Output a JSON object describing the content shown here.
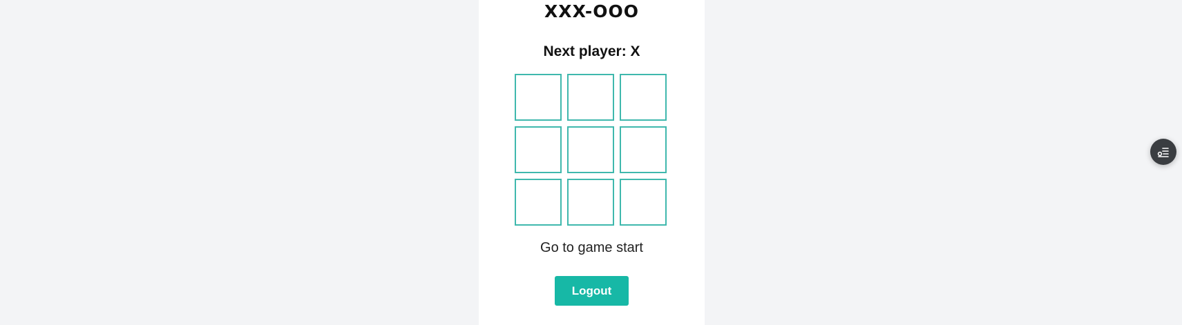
{
  "game": {
    "title": "XXX-OOO",
    "status": "Next player: X",
    "board": [
      "",
      "",
      "",
      "",
      "",
      "",
      "",
      "",
      ""
    ],
    "history_link": "Go to game start"
  },
  "actions": {
    "logout_label": "Logout"
  },
  "floating_button": {
    "icon": "settings-list-icon"
  },
  "colors": {
    "accent": "#17b8a6",
    "cell_border": "#3fb8ad",
    "background": "#f3f4f6",
    "card": "#ffffff"
  }
}
